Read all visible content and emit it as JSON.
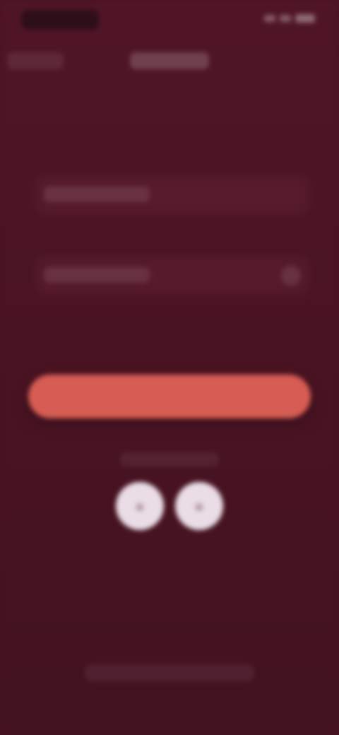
{
  "status_bar": {
    "time": "",
    "icons": [
      "signal-icon",
      "wifi-icon",
      "battery-icon"
    ]
  },
  "tabs": [
    {
      "label": ""
    },
    {
      "label": ""
    }
  ],
  "form": {
    "username_placeholder": "",
    "password_placeholder": "",
    "eye_icon": "eye-icon"
  },
  "primary_button": {
    "label": ""
  },
  "alternate_login": {
    "label": "",
    "providers": [
      "provider-one-icon",
      "provider-two-icon"
    ]
  },
  "footer": {
    "text": ""
  },
  "colors": {
    "background": "#4a1322",
    "primary": "#d65d53",
    "social_button": "#eadde6"
  }
}
